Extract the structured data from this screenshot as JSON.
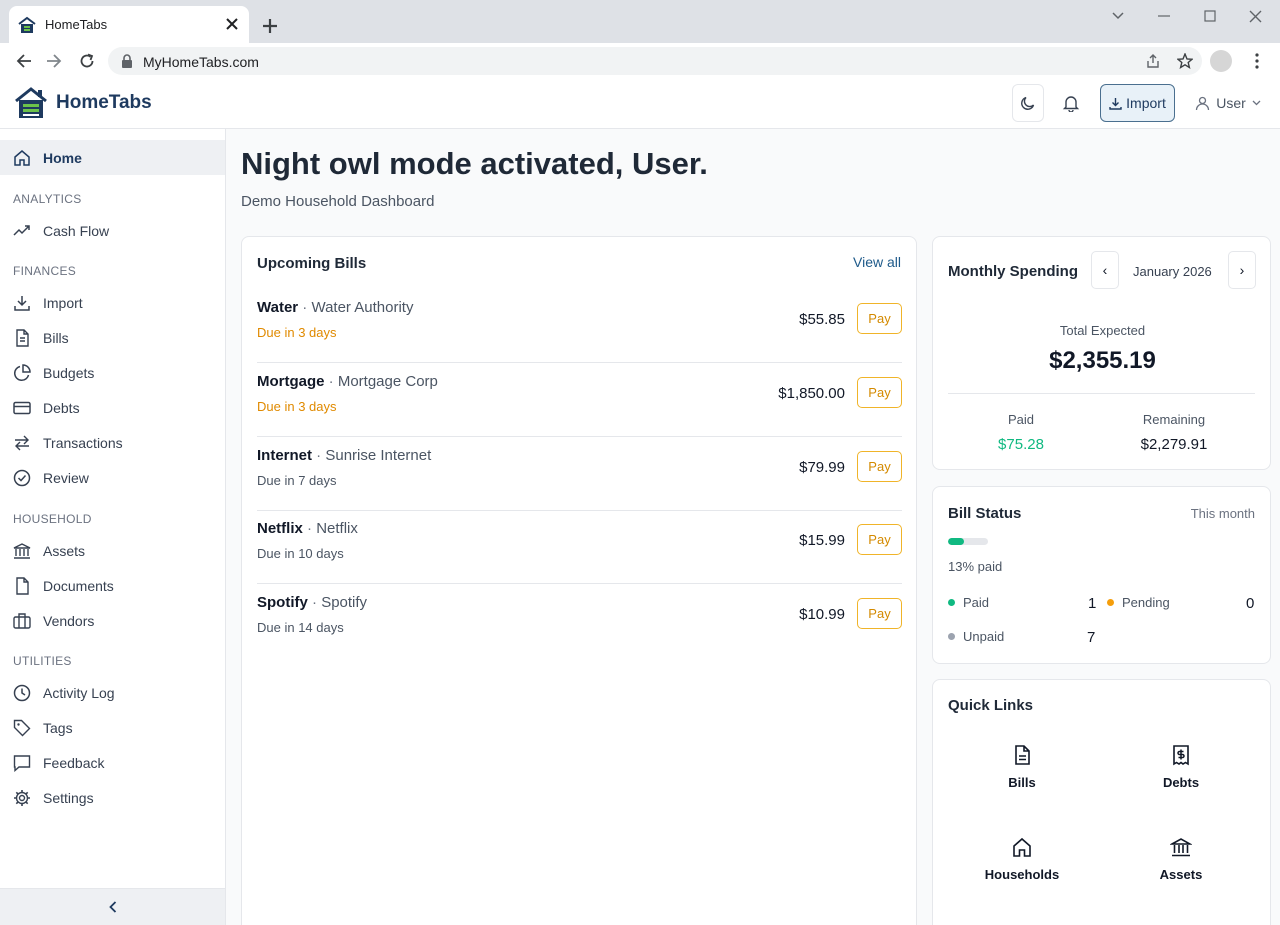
{
  "browser": {
    "tab_title": "HomeTabs",
    "url": "MyHomeTabs.com"
  },
  "header": {
    "brand": "HomeTabs",
    "import_label": "Import",
    "user_label": "User"
  },
  "sidebar": {
    "home": "Home",
    "sections": {
      "analytics": "ANALYTICS",
      "finances": "FINANCES",
      "household": "HOUSEHOLD",
      "utilities": "UTILITIES"
    },
    "items": {
      "cash_flow": "Cash Flow",
      "import": "Import",
      "bills": "Bills",
      "budgets": "Budgets",
      "debts": "Debts",
      "transactions": "Transactions",
      "review": "Review",
      "assets": "Assets",
      "documents": "Documents",
      "vendors": "Vendors",
      "activity_log": "Activity Log",
      "tags": "Tags",
      "feedback": "Feedback",
      "settings": "Settings"
    }
  },
  "main": {
    "greeting": "Night owl mode activated, User.",
    "subtitle": "Demo Household Dashboard"
  },
  "upcoming_bills": {
    "title": "Upcoming Bills",
    "view_all": "View all",
    "pay_label": "Pay",
    "rows": [
      {
        "name": "Water",
        "sep": " · ",
        "vendor": "Water Authority",
        "due": "Due in 3 days",
        "amount": "$55.85"
      },
      {
        "name": "Mortgage",
        "sep": " · ",
        "vendor": "Mortgage Corp",
        "due": "Due in 3 days",
        "amount": "$1,850.00"
      },
      {
        "name": "Internet",
        "sep": " · ",
        "vendor": "Sunrise Internet",
        "due": "Due in 7 days",
        "amount": "$79.99"
      },
      {
        "name": "Netflix",
        "sep": " · ",
        "vendor": "Netflix",
        "due": "Due in 10 days",
        "amount": "$15.99"
      },
      {
        "name": "Spotify",
        "sep": " · ",
        "vendor": "Spotify",
        "due": "Due in 14 days",
        "amount": "$10.99"
      }
    ]
  },
  "monthly_spending": {
    "title": "Monthly Spending",
    "prev": "‹",
    "next": "›",
    "month": "January 2026",
    "total_label": "Total Expected",
    "total": "$2,355.19",
    "paid_label": "Paid",
    "paid": "$75.28",
    "remaining_label": "Remaining",
    "remaining": "$2,279.91"
  },
  "bill_status": {
    "title": "Bill Status",
    "period": "This month",
    "paid_fraction": 0.13,
    "paid_percent_label": "13% paid",
    "paid_label": "Paid",
    "paid_count": "1",
    "pending_label": "Pending",
    "pending_count": "0",
    "unpaid_label": "Unpaid",
    "unpaid_count": "7",
    "colors": {
      "paid": "#10b981",
      "pending": "#f59e0b",
      "unpaid": "#9ca3af"
    }
  },
  "quick_links": {
    "title": "Quick Links",
    "items": [
      "Bills",
      "Debts",
      "Households",
      "Assets"
    ]
  },
  "icons": {
    "sidebar": [
      "home-icon",
      "trend-icon",
      "download-icon",
      "file-icon",
      "pie-chart-icon",
      "credit-card-icon",
      "arrows-icon",
      "check-circle-icon",
      "bank-icon",
      "document-icon",
      "briefcase-icon",
      "clock-icon",
      "tag-icon",
      "message-icon",
      "gear-icon"
    ],
    "header": [
      "moon-icon",
      "bell-icon",
      "download-icon",
      "user-icon",
      "chevron-down-icon"
    ]
  },
  "colors": {
    "brand": "#1e3a5f",
    "accent_orange": "#e08a00",
    "paid_green": "#10b981"
  }
}
